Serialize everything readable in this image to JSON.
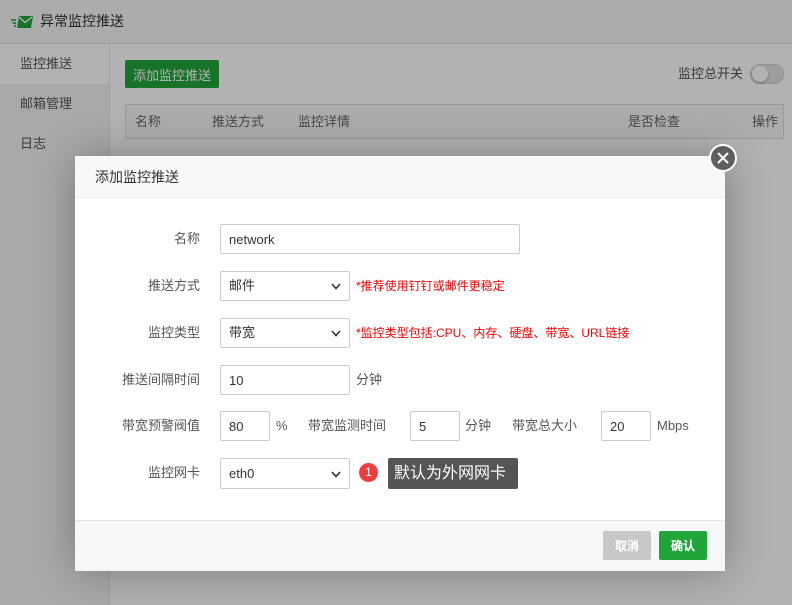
{
  "window": {
    "title": "异常监控推送",
    "icon": "mail-send-icon"
  },
  "sidebar": {
    "items": [
      {
        "label": "监控推送",
        "active": true
      },
      {
        "label": "邮箱管理",
        "active": false
      },
      {
        "label": "日志",
        "active": false
      }
    ]
  },
  "main": {
    "add_button": "添加监控推送",
    "master_switch": {
      "label": "监控总开关",
      "on": false
    },
    "table": {
      "columns": [
        "名称",
        "推送方式",
        "监控详情",
        "是否检查",
        "操作"
      ]
    }
  },
  "dialog": {
    "title": "添加监控推送",
    "close_icon": "close-icon",
    "fields": {
      "name": {
        "label": "名称",
        "value": "network"
      },
      "push_method": {
        "label": "推送方式",
        "value": "邮件",
        "hint": "*推荐使用钉钉或邮件更稳定"
      },
      "monitor_type": {
        "label": "监控类型",
        "value": "带宽",
        "hint": "*监控类型包括:CPU、内存、硬盘、带宽、URL链接"
      },
      "interval": {
        "label": "推送间隔时间",
        "value": "10",
        "unit": "分钟"
      },
      "bandwidth_threshold": {
        "label": "带宽预警阀值",
        "value": "80",
        "unit": "%"
      },
      "bandwidth_check_time": {
        "label": "带宽监测时间",
        "value": "5",
        "unit": "分钟"
      },
      "bandwidth_total": {
        "label": "带宽总大小",
        "value": "20",
        "unit": "Mbps"
      },
      "nic": {
        "label": "监控网卡",
        "value": "eth0"
      }
    },
    "tooltip": {
      "badge": "1",
      "text": "默认为外网网卡"
    },
    "buttons": {
      "cancel": "取消",
      "confirm": "确认"
    }
  },
  "colors": {
    "accent": "#20a53a",
    "hint": "#ff0000",
    "tooltip_bg": "#555555",
    "badge": "#f03c3c",
    "cancel_button": "#c8c8c8"
  }
}
